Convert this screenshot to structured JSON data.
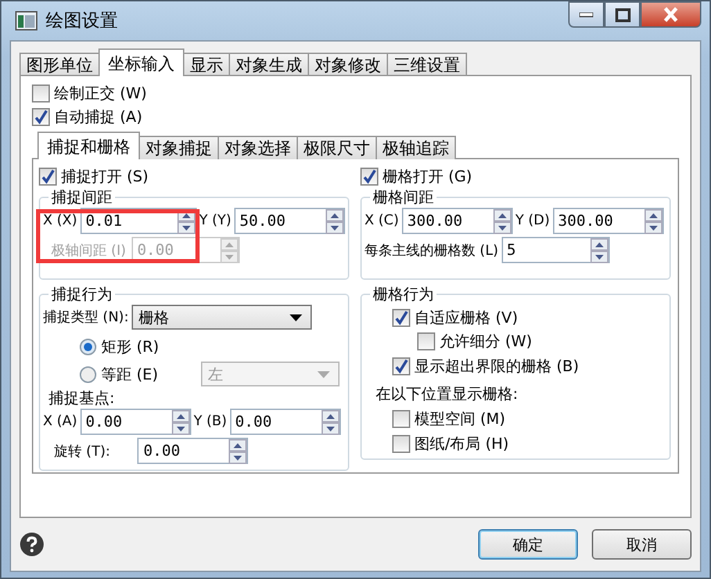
{
  "window": {
    "title": "绘图设置"
  },
  "tabs": [
    {
      "label": "图形单位",
      "selected": false
    },
    {
      "label": "坐标输入",
      "selected": true
    },
    {
      "label": "显示",
      "selected": false
    },
    {
      "label": "对象生成",
      "selected": false
    },
    {
      "label": "对象修改",
      "selected": false
    },
    {
      "label": "三维设置",
      "selected": false
    }
  ],
  "options": [
    {
      "label": "绘制正交 (W)",
      "checked": false
    },
    {
      "label": "自动捕捉 (A)",
      "checked": true
    }
  ],
  "subtabs": [
    {
      "label": "捕捉和栅格",
      "selected": true
    },
    {
      "label": "对象捕捉",
      "selected": false
    },
    {
      "label": "对象选择",
      "selected": false
    },
    {
      "label": "极限尺寸",
      "selected": false
    },
    {
      "label": "极轴追踪",
      "selected": false
    }
  ],
  "snap": {
    "toggle": {
      "label": "捕捉打开 (S)",
      "checked": true
    },
    "spacing": {
      "title": "捕捉间距",
      "fields": [
        {
          "label": "X (X)",
          "value": "0.01",
          "disabled": false
        },
        {
          "label": "Y (Y)",
          "value": "50.00",
          "disabled": false
        }
      ],
      "polar": {
        "label": "极轴间距 (I)",
        "value": "0.00",
        "disabled": true
      }
    },
    "behavior": {
      "title": "捕捉行为",
      "type_label": "捕捉类型 (N):",
      "type_value": "栅格",
      "radios": [
        {
          "label": "矩形 (R)",
          "selected": true
        },
        {
          "label": "等距 (E)",
          "selected": false
        }
      ],
      "iso": {
        "value": "左",
        "disabled": true
      },
      "base_title": "捕捉基点:",
      "base": [
        {
          "label": "X (A)",
          "value": "0.00",
          "disabled": false
        },
        {
          "label": "Y (B)",
          "value": "0.00",
          "disabled": false
        }
      ],
      "rotation": {
        "label": "旋转 (T):",
        "value": "0.00",
        "disabled": false
      }
    }
  },
  "grid": {
    "toggle": {
      "label": "栅格打开 (G)",
      "checked": true
    },
    "spacing": {
      "title": "栅格间距",
      "fields": [
        {
          "label": "X (C)",
          "value": "300.00",
          "disabled": false
        },
        {
          "label": "Y (D)",
          "value": "300.00",
          "disabled": false
        }
      ],
      "major": {
        "label": "每条主线的栅格数 (L)",
        "value": "5",
        "disabled": false
      }
    },
    "behavior": {
      "title": "栅格行为",
      "options": [
        {
          "label": "自适应栅格 (V)",
          "checked": true,
          "children": [
            {
              "label": "允许细分 (W)",
              "checked": false
            }
          ]
        },
        {
          "label": "显示超出界限的栅格 (B)",
          "checked": true
        }
      ],
      "show_title": "在以下位置显示栅格:",
      "show_in": [
        {
          "label": "模型空间 (M)",
          "checked": false
        },
        {
          "label": "图纸/布局 (H)",
          "checked": false
        }
      ]
    }
  },
  "buttons": [
    {
      "label": "确定",
      "default": true
    },
    {
      "label": "取消",
      "default": false
    }
  ]
}
